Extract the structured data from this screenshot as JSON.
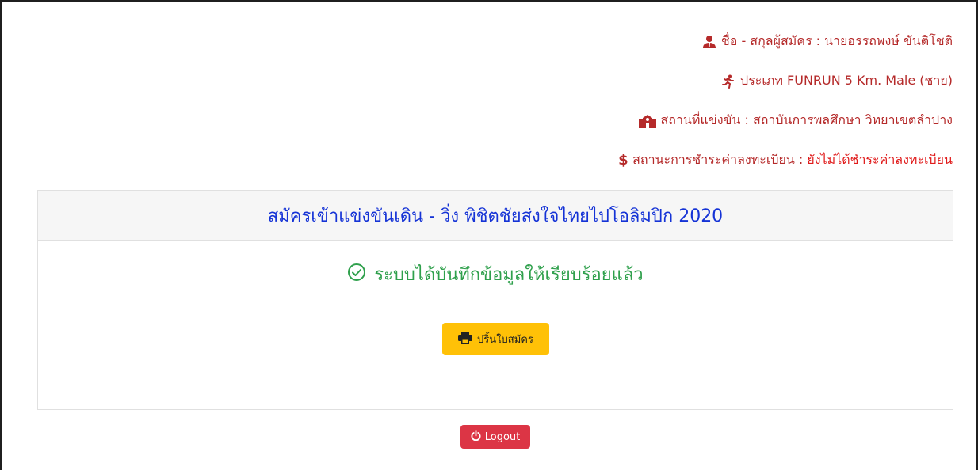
{
  "applicant": {
    "name_label": "ชื่อ - สกุลผู้สมัคร : นายอรรถพงษ์ ขันติโชติ",
    "type_label": "ประเภท FUNRUN 5 Km. Male (ชาย)",
    "venue_label": "สถานที่แข่งขัน : สถาบันการพลศึกษา วิทยาเขตลำปาง",
    "payment_prefix": "สถานะการชำระค่าลงทะเบียน : ",
    "payment_status": "ยังไม่ได้ชำระค่าลงทะเบียน"
  },
  "card": {
    "title": "สมัครเข้าแข่งขันเดิน - วิ่ง พิชิตชัยส่งใจไทยไปโอลิมปิก 2020",
    "success_message": "ระบบได้บันทึกข้อมูลให้เรียบร้อยแล้ว",
    "print_button": "ปริ้นใบสมัคร"
  },
  "logout_button": "Logout",
  "colors": {
    "info_text": "#b52a2a",
    "payment_status": "#e01b1b",
    "title": "#1533d6",
    "success": "#2fa04c",
    "print_button_bg": "#ffc107",
    "logout_button_bg": "#dc3545"
  },
  "icons": {
    "name": "user-tie-icon",
    "type": "running-icon",
    "venue": "school-building-icon",
    "payment": "dollar-icon",
    "success": "check-circle-icon",
    "print": "print-icon",
    "logout": "power-icon"
  }
}
